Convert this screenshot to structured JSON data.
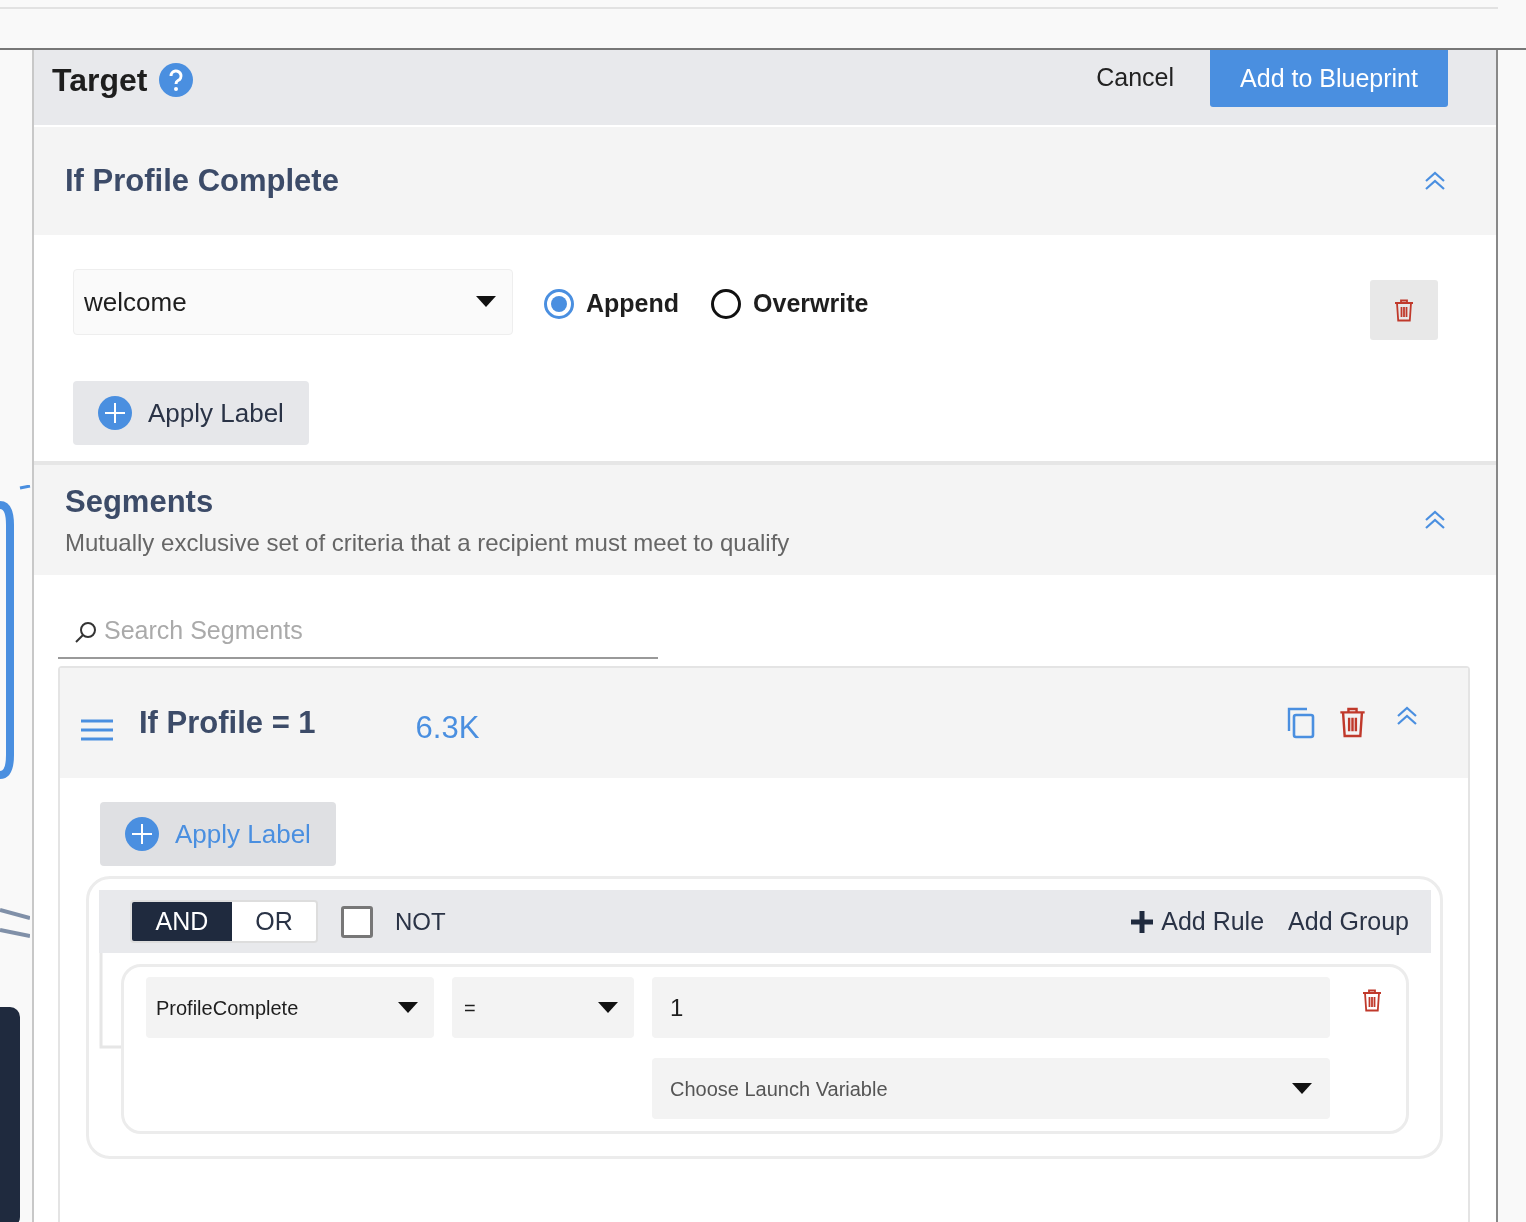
{
  "header": {
    "title": "Target",
    "cancel": "Cancel",
    "primary": "Add to Blueprint"
  },
  "profile_section": {
    "title": "If Profile Complete",
    "expanded": true,
    "label_select": {
      "value": "welcome"
    },
    "mode_options": [
      {
        "label": "Append",
        "selected": true
      },
      {
        "label": "Overwrite",
        "selected": false
      }
    ],
    "apply_label": "Apply Label"
  },
  "segments_section": {
    "title": "Segments",
    "description": "Mutually exclusive set of criteria that a recipient must meet to qualify",
    "expanded": true,
    "search": {
      "placeholder": "Search Segments"
    },
    "segments": [
      {
        "title": "If Profile = 1",
        "count": "6.3K",
        "expanded": true,
        "apply_label": "Apply Label",
        "logic": [
          {
            "label": "AND",
            "selected": true
          },
          {
            "label": "OR",
            "selected": false
          }
        ],
        "not": {
          "label": "NOT",
          "checked": false
        },
        "add_rule": "Add Rule",
        "add_group": "Add Group",
        "rules": [
          {
            "field": "ProfileComplete",
            "operator": "=",
            "value": "1",
            "launch_variable": {
              "placeholder": "Choose Launch Variable"
            }
          }
        ]
      }
    ]
  }
}
